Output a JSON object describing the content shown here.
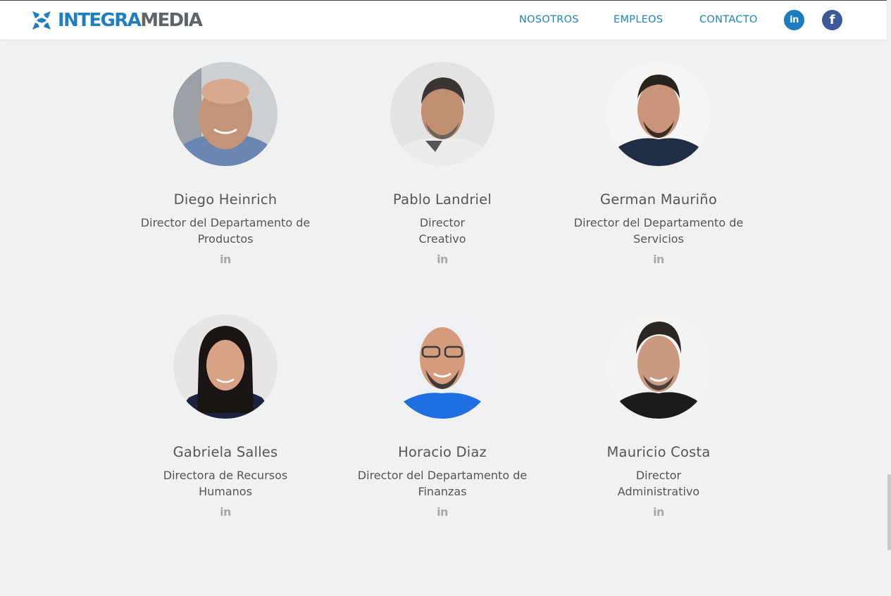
{
  "header": {
    "logo_part1": "INTEGRA",
    "logo_part2": "MEDIA",
    "nav": [
      "NOSOTROS",
      "EMPLEOS",
      "CONTACTO"
    ],
    "social": [
      {
        "icon": "linkedin-icon",
        "glyph": "in",
        "color": "#1c7cbf"
      },
      {
        "icon": "facebook-icon",
        "glyph": "f",
        "color": "#3c5a9a"
      }
    ]
  },
  "colors": {
    "brand_blue": "#1f7ec0",
    "brand_gray": "#5f6468",
    "nav_link": "#1f82c0",
    "background": "#f1f1f1",
    "text": "#555555",
    "linkedin_small": "#a8a8a8"
  },
  "team": [
    {
      "name": "Diego Heinrich",
      "role_line1": "Director del Departamento de",
      "role_line2": "Productos",
      "icon": "in"
    },
    {
      "name": "Pablo Landriel",
      "role_line1": "Director",
      "role_line2": "Creativo",
      "icon": "in"
    },
    {
      "name": "German Mauriño",
      "role_line1": "Director del Departamento de",
      "role_line2": "Servicios",
      "icon": "in"
    },
    {
      "name": "Gabriela Salles",
      "role_line1": "Directora de Recursos",
      "role_line2": "Humanos",
      "icon": "in"
    },
    {
      "name": "Horacio Diaz",
      "role_line1": "Director del Departamento de",
      "role_line2": "Finanzas",
      "icon": "in"
    },
    {
      "name": "Mauricio Costa",
      "role_line1": "Director",
      "role_line2": "Administrativo",
      "icon": "in"
    }
  ]
}
